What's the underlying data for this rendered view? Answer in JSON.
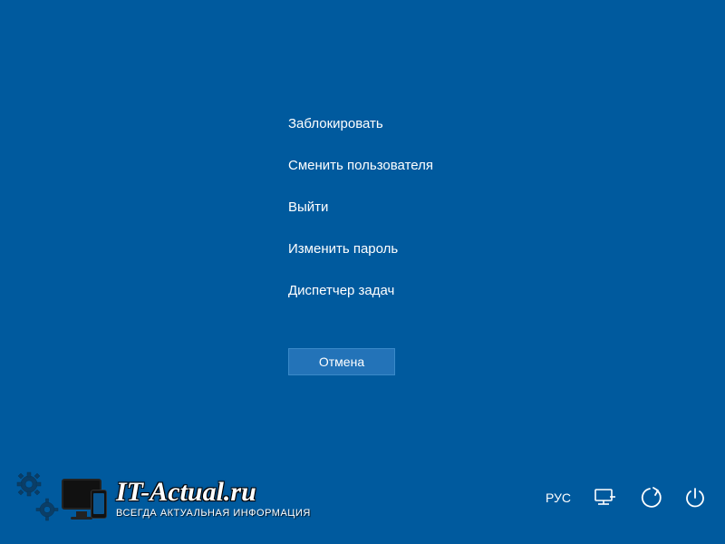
{
  "menu": {
    "items": [
      {
        "label": "Заблокировать"
      },
      {
        "label": "Сменить пользователя"
      },
      {
        "label": "Выйти"
      },
      {
        "label": "Изменить пароль"
      },
      {
        "label": "Диспетчер задач"
      }
    ]
  },
  "cancel": {
    "label": "Отмена"
  },
  "footer": {
    "language": "РУС"
  },
  "watermark": {
    "title": "IT-Actual.ru",
    "subtitle": "ВСЕГДА АКТУАЛЬНАЯ ИНФОРМАЦИЯ"
  }
}
